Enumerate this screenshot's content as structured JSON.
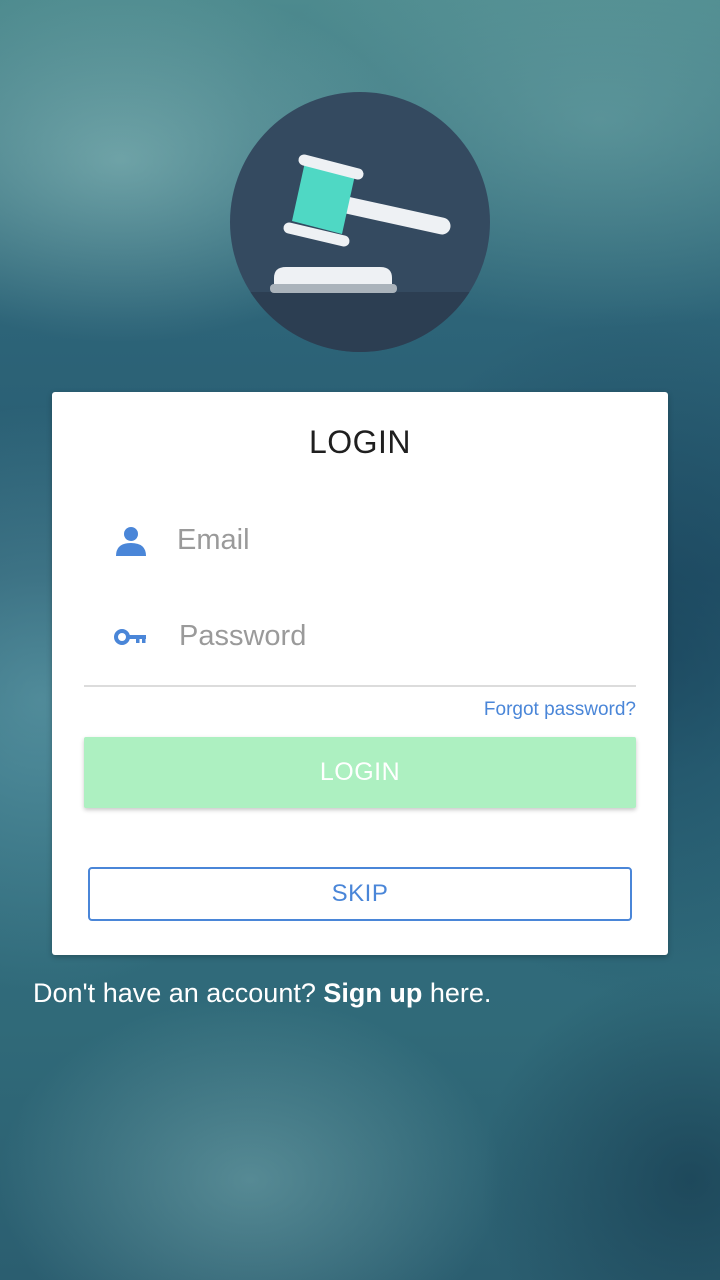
{
  "logo": {
    "icon": "gavel-icon",
    "colors": {
      "circle": "#344a60",
      "circle_shadow": "#2c3e52",
      "gavel_head": "#4fd8c4",
      "gavel_caps": "#eef1f4",
      "base": "#eef1f4",
      "base_shadow": "#aab3bb"
    }
  },
  "login_card": {
    "title": "LOGIN",
    "email": {
      "icon": "user-icon",
      "placeholder": "Email",
      "value": ""
    },
    "password": {
      "icon": "key-icon",
      "placeholder": "Password",
      "value": ""
    },
    "forgot_password": "Forgot password?",
    "login_button": "LOGIN",
    "skip_button": "SKIP"
  },
  "signup": {
    "prefix": "Don't have an account? ",
    "link": "Sign up",
    "suffix": " here."
  },
  "colors": {
    "accent_blue": "#4a86d8",
    "login_button_bg": "#adf0c1",
    "card_bg": "#ffffff"
  }
}
